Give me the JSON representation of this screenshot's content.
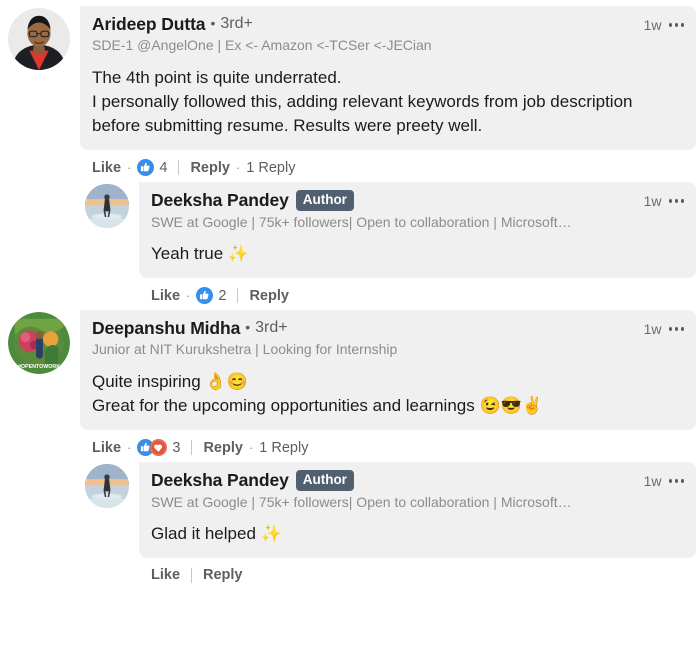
{
  "thread": {
    "comments": [
      {
        "id": "comment-arideep-dutta",
        "level": "top",
        "avatar": "photo-man-glasses-red-shirt",
        "name": "Arideep Dutta",
        "separator": "•",
        "degree": "3rd+",
        "is_author": false,
        "author_badge": "",
        "headline": "SDE-1 @AngelOne | Ex <- Amazon <-TCSer <-JECian",
        "time": "1w",
        "menu_icon": "overflow-menu-icon",
        "text": "The 4th point is quite underrated.\nI personally followed this, adding relevant keywords from job description before submitting resume. Results were preety well.",
        "like_label": "Like",
        "reactions": [
          "like",
          ""
        ],
        "reaction_count": "4",
        "reply_label": "Reply",
        "replies_label": "1 Reply",
        "has_replies_link": true,
        "has_reactions": true
      },
      {
        "id": "comment-deeksha-pandey-1",
        "level": "reply",
        "avatar": "photo-woman-beach-sunset",
        "name": "Deeksha Pandey",
        "separator": "",
        "degree": "",
        "is_author": true,
        "author_badge": "Author",
        "headline": "SWE at Google | 75k+ followers| Open to collaboration | Microsoft…",
        "time": "1w",
        "menu_icon": "overflow-menu-icon",
        "text": "Yeah true ✨",
        "like_label": "Like",
        "reactions": [
          "like",
          ""
        ],
        "reaction_count": "2",
        "reply_label": "Reply",
        "replies_label": "",
        "has_replies_link": false,
        "has_reactions": true
      },
      {
        "id": "comment-deepanshu-midha",
        "level": "top",
        "avatar": "photo-opentowork-ring",
        "name": "Deepanshu Midha",
        "separator": "•",
        "degree": "3rd+",
        "is_author": false,
        "author_badge": "",
        "headline": "Junior at NIT Kurukshetra | Looking for Internship",
        "time": "1w",
        "menu_icon": "overflow-menu-icon",
        "text": "Quite inspiring 👌😊\nGreat for the upcoming opportunities and learnings 😉😎✌️",
        "like_label": "Like",
        "reactions": [
          "like",
          "love"
        ],
        "reaction_count": "3",
        "reply_label": "Reply",
        "replies_label": "1 Reply",
        "has_replies_link": true,
        "has_reactions": true
      },
      {
        "id": "comment-deeksha-pandey-2",
        "level": "reply",
        "avatar": "photo-woman-beach-sunset",
        "name": "Deeksha Pandey",
        "separator": "",
        "degree": "",
        "is_author": true,
        "author_badge": "Author",
        "headline": "SWE at Google | 75k+ followers| Open to collaboration | Microsoft…",
        "time": "1w",
        "menu_icon": "overflow-menu-icon",
        "text": "Glad it helped ✨",
        "like_label": "Like",
        "reactions": [],
        "reaction_count": "",
        "reply_label": "Reply",
        "replies_label": "",
        "has_replies_link": false,
        "has_reactions": false
      }
    ]
  },
  "colors": {
    "bubble_background": "#f0f0f0",
    "page_background": "#ffffff",
    "author_badge_background": "#51606e",
    "like_reaction_blue": "#378fe9",
    "love_reaction_red": "#df704d",
    "text_primary": "#1b1b1b",
    "text_secondary": "#5e5e5e",
    "text_tertiary": "#8c8c8c"
  }
}
